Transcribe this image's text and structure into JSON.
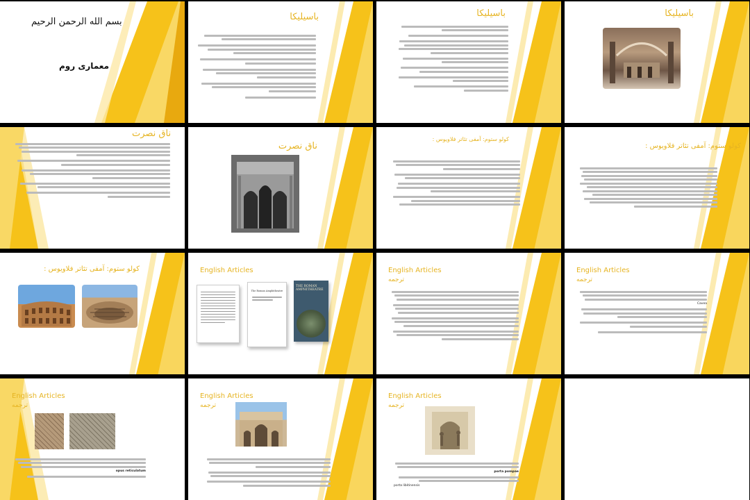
{
  "slides": [
    {
      "title": "بسم الله الرحمن الرحیم",
      "subtitle": "معماری روم"
    },
    {
      "title": "باسیلیکا"
    },
    {
      "title": "باسیلیکا"
    },
    {
      "title": "باسیلیکا"
    },
    {
      "title": "ناق نصرت"
    },
    {
      "title": "ناق نصرت"
    },
    {
      "title": "کولو ستوم: آمفی تئاتر فلاویوس :"
    },
    {
      "title": "کولو ستوم: آمفی تئاتر فلاویوس :"
    },
    {
      "title": "کولو ستوم: آمفی تئاتر فلاویوس :"
    },
    {
      "title": "English Articles"
    },
    {
      "title": "English Articles",
      "subtitle": "ترجمه"
    },
    {
      "title": "English Articles",
      "subtitle": "ترجمه"
    },
    {
      "title": "English Articles",
      "subtitle": "ترجمه"
    },
    {
      "title": "English Articles",
      "subtitle": "ترجمه"
    },
    {
      "title": "English Articles",
      "subtitle": "ترجمه"
    }
  ],
  "books": {
    "b2_title": "The Roman Amphitheatre",
    "b3_title": "THE ROMAN AMPHITHEATRE"
  },
  "terms": {
    "caves": "Cavea",
    "opus1": "opus reticulatum",
    "opus2": "opus reticulatum",
    "porta": "porta pompae",
    "porta2": "porta libitinensis"
  }
}
